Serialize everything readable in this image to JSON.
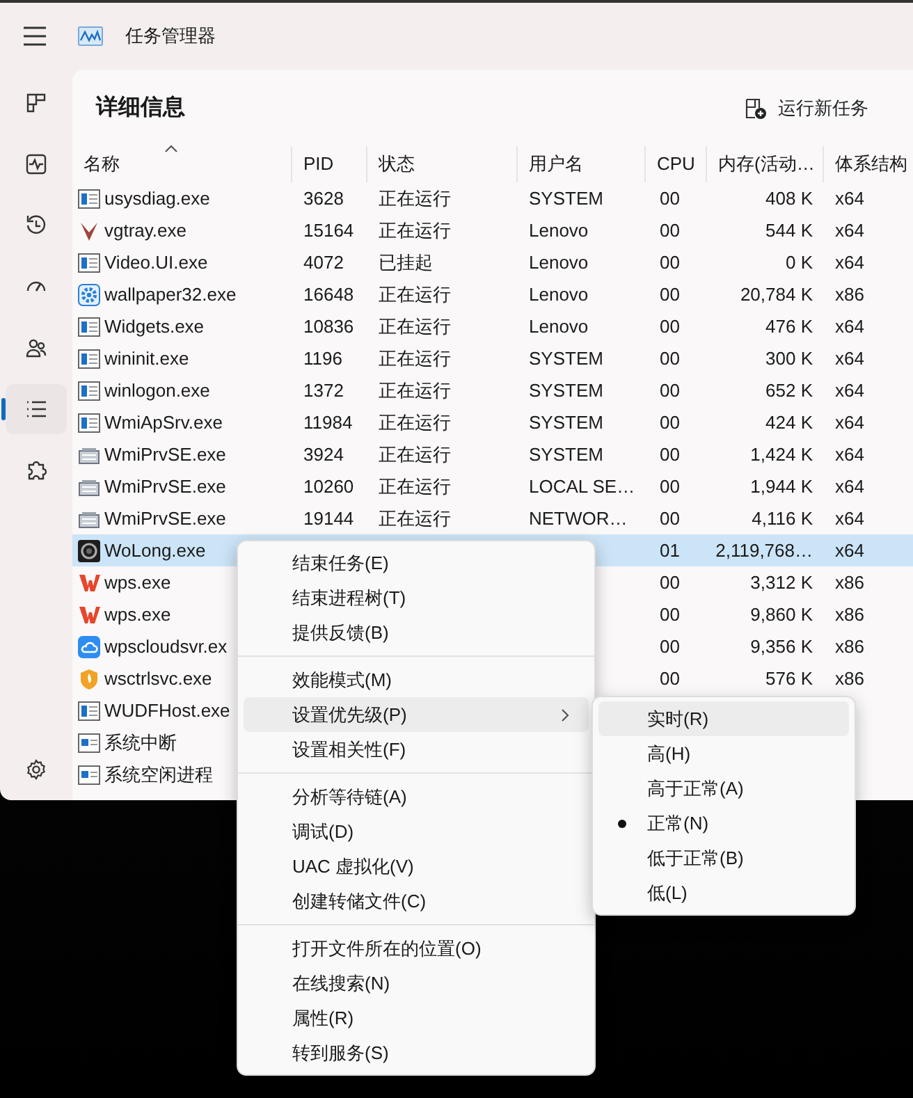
{
  "window": {
    "title": "任务管理器"
  },
  "sidebar": {
    "items": [
      {
        "kind": "processes",
        "selected": false
      },
      {
        "kind": "performance",
        "selected": false
      },
      {
        "kind": "history",
        "selected": false
      },
      {
        "kind": "startup",
        "selected": false
      },
      {
        "kind": "users",
        "selected": false
      },
      {
        "kind": "details",
        "selected": true
      },
      {
        "kind": "services",
        "selected": false
      }
    ]
  },
  "page": {
    "title": "详细信息",
    "run_task_button": "运行新任务"
  },
  "table": {
    "columns": [
      {
        "label": "名称",
        "sorted": true
      },
      {
        "label": "PID",
        "sorted": false
      },
      {
        "label": "状态",
        "sorted": false
      },
      {
        "label": "用户名",
        "sorted": false
      },
      {
        "label": "CPU",
        "sorted": false
      },
      {
        "label": "内存(活动…",
        "sorted": false
      },
      {
        "label": "体系结构",
        "sorted": false
      }
    ],
    "rows": [
      {
        "kind": "app",
        "name": "usysdiag.exe",
        "pid": "3628",
        "status": "正在运行",
        "user": "SYSTEM",
        "cpu": "00",
        "memory": "408 K",
        "arch": "x64",
        "selected": false
      },
      {
        "kind": "v",
        "name": "vgtray.exe",
        "pid": "15164",
        "status": "正在运行",
        "user": "Lenovo",
        "cpu": "00",
        "memory": "544 K",
        "arch": "x64",
        "selected": false
      },
      {
        "kind": "app",
        "name": "Video.UI.exe",
        "pid": "4072",
        "status": "已挂起",
        "user": "Lenovo",
        "cpu": "00",
        "memory": "0 K",
        "arch": "x64",
        "selected": false
      },
      {
        "kind": "gear",
        "name": "wallpaper32.exe",
        "pid": "16648",
        "status": "正在运行",
        "user": "Lenovo",
        "cpu": "00",
        "memory": "20,784 K",
        "arch": "x86",
        "selected": false
      },
      {
        "kind": "app",
        "name": "Widgets.exe",
        "pid": "10836",
        "status": "正在运行",
        "user": "Lenovo",
        "cpu": "00",
        "memory": "476 K",
        "arch": "x64",
        "selected": false
      },
      {
        "kind": "app",
        "name": "wininit.exe",
        "pid": "1196",
        "status": "正在运行",
        "user": "SYSTEM",
        "cpu": "00",
        "memory": "300 K",
        "arch": "x64",
        "selected": false
      },
      {
        "kind": "app",
        "name": "winlogon.exe",
        "pid": "1372",
        "status": "正在运行",
        "user": "SYSTEM",
        "cpu": "00",
        "memory": "652 K",
        "arch": "x64",
        "selected": false
      },
      {
        "kind": "app",
        "name": "WmiApSrv.exe",
        "pid": "11984",
        "status": "正在运行",
        "user": "SYSTEM",
        "cpu": "00",
        "memory": "424 K",
        "arch": "x64",
        "selected": false
      },
      {
        "kind": "wmi",
        "name": "WmiPrvSE.exe",
        "pid": "3924",
        "status": "正在运行",
        "user": "SYSTEM",
        "cpu": "00",
        "memory": "1,424 K",
        "arch": "x64",
        "selected": false
      },
      {
        "kind": "wmi",
        "name": "WmiPrvSE.exe",
        "pid": "10260",
        "status": "正在运行",
        "user": "LOCAL SE…",
        "cpu": "00",
        "memory": "1,944 K",
        "arch": "x64",
        "selected": false
      },
      {
        "kind": "wmi",
        "name": "WmiPrvSE.exe",
        "pid": "19144",
        "status": "正在运行",
        "user": "NETWOR…",
        "cpu": "00",
        "memory": "4,116 K",
        "arch": "x64",
        "selected": false
      },
      {
        "kind": "dark",
        "name": "WoLong.exe",
        "cpu": "01",
        "memory": "2,119,768…",
        "arch": "x64",
        "selected": true
      },
      {
        "kind": "wps",
        "name": "wps.exe",
        "cpu": "00",
        "memory": "3,312 K",
        "arch": "x86",
        "selected": false
      },
      {
        "kind": "wps",
        "name": "wps.exe",
        "cpu": "00",
        "memory": "9,860 K",
        "arch": "x86",
        "selected": false
      },
      {
        "kind": "cloud",
        "name": "wpscloudsvr.ex",
        "cpu": "00",
        "memory": "9,356 K",
        "arch": "x86",
        "selected": false
      },
      {
        "kind": "shield",
        "name": "wsctrlsvc.exe",
        "cpu": "00",
        "memory": "576 K",
        "arch": "x86",
        "selected": false
      },
      {
        "kind": "app",
        "name": "WUDFHost.exe",
        "selected": false
      },
      {
        "kind": "sys",
        "name": "系统中断",
        "selected": false
      },
      {
        "kind": "sys",
        "name": "系统空闲进程",
        "selected": false
      }
    ]
  },
  "context_menu": {
    "groups": [
      {
        "items": [
          {
            "label": "结束任务(E)",
            "expanded": false
          },
          {
            "label": "结束进程树(T)",
            "expanded": false
          },
          {
            "label": "提供反馈(B)",
            "expanded": false
          }
        ]
      },
      {
        "items": [
          {
            "label": "效能模式(M)",
            "expanded": false
          },
          {
            "label": "设置优先级(P)",
            "expanded": true,
            "submenu": true
          },
          {
            "label": "设置相关性(F)",
            "expanded": false
          }
        ]
      },
      {
        "items": [
          {
            "label": "分析等待链(A)",
            "expanded": false
          },
          {
            "label": "调试(D)",
            "expanded": false
          },
          {
            "label": "UAC 虚拟化(V)",
            "expanded": false
          },
          {
            "label": "创建转储文件(C)",
            "expanded": false
          }
        ]
      },
      {
        "items": [
          {
            "label": "打开文件所在的位置(O)",
            "expanded": false
          },
          {
            "label": "在线搜索(N)",
            "expanded": false
          },
          {
            "label": "属性(R)",
            "expanded": false
          },
          {
            "label": "转到服务(S)",
            "expanded": false
          }
        ]
      }
    ]
  },
  "priority_menu": {
    "items": [
      {
        "label": "实时(R)",
        "hovered": true,
        "checked": false
      },
      {
        "label": "高(H)",
        "hovered": false,
        "checked": false
      },
      {
        "label": "高于正常(A)",
        "hovered": false,
        "checked": false
      },
      {
        "label": "正常(N)",
        "hovered": false,
        "checked": true
      },
      {
        "label": "低于正常(B)",
        "hovered": false,
        "checked": false
      },
      {
        "label": "低(L)",
        "hovered": false,
        "checked": false
      }
    ]
  }
}
